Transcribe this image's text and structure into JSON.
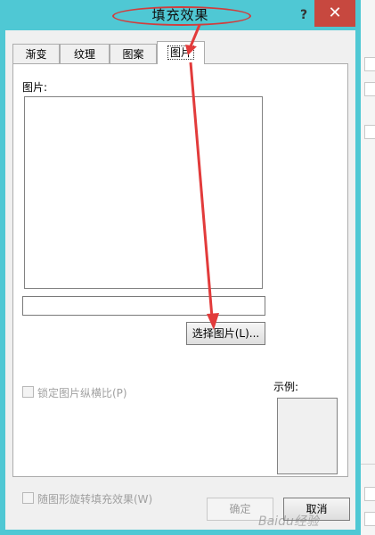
{
  "window": {
    "title": "填充效果",
    "help_label": "?",
    "close_label": "✕"
  },
  "tabs": [
    {
      "label": "渐变",
      "active": false
    },
    {
      "label": "纹理",
      "active": false
    },
    {
      "label": "图案",
      "active": false
    },
    {
      "label": "图片",
      "active": true
    }
  ],
  "picture_panel": {
    "picture_label": "图片:",
    "file_path_value": "",
    "select_button_label": "选择图片(L)...",
    "lock_aspect_label": "锁定图片纵横比(P)",
    "lock_aspect_checked": false,
    "rotate_with_shape_label": "随图形旋转填充效果(W)",
    "rotate_with_shape_checked": false,
    "sample_label": "示例:"
  },
  "buttons": {
    "ok_label": "确定",
    "cancel_label": "取消"
  },
  "colors": {
    "window_frame": "#4fc8d4",
    "close_button": "#c7483f",
    "annotation_red": "#e23b3b"
  },
  "watermark": "Baidu经验"
}
